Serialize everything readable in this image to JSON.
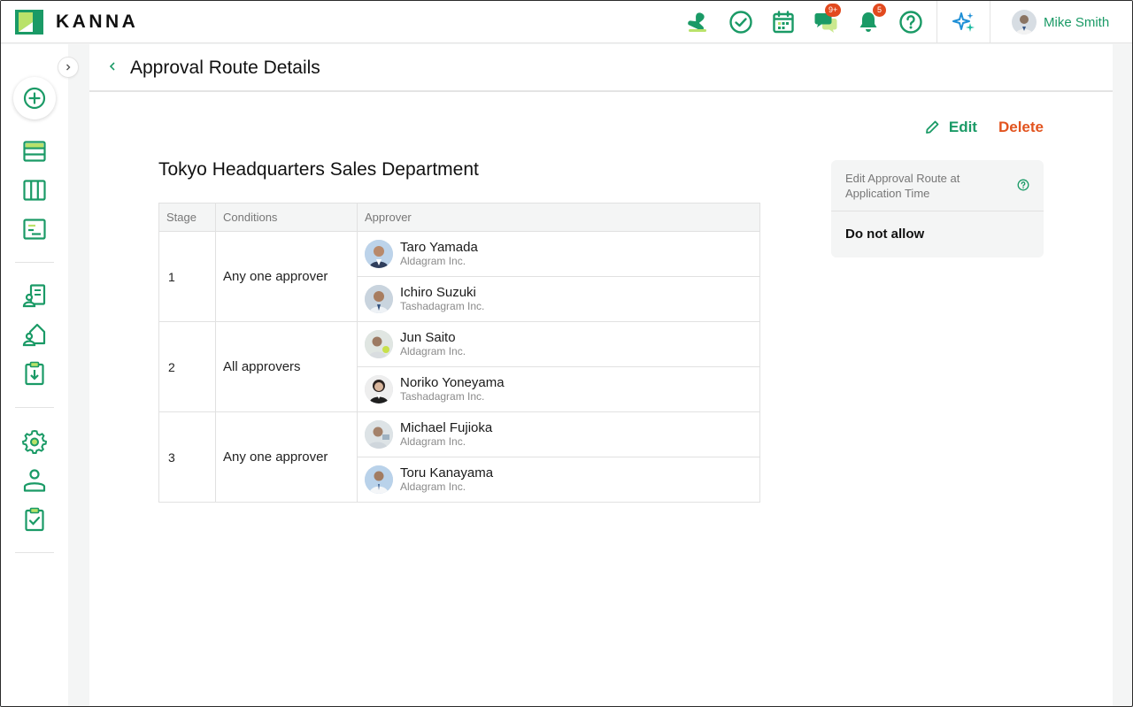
{
  "app": {
    "name": "KANNA"
  },
  "header": {
    "badges": {
      "messages": "9+",
      "notifications": "5"
    },
    "user_name": "Mike Smith",
    "accent": "#1a9a66",
    "badge_color": "#e24a1f",
    "icons": [
      "stamp-icon",
      "check-circle-icon",
      "calendar-icon",
      "chat-icon",
      "bell-icon",
      "help-icon",
      "sparkle-icon"
    ]
  },
  "sidebar": {
    "icons": [
      "add-icon",
      "list-icon",
      "columns-icon",
      "document-icon",
      "building-person-icon",
      "house-person-icon",
      "download-clipboard-icon",
      "gear-icon",
      "person-icon",
      "clipboard-check-icon"
    ]
  },
  "page": {
    "title": "Approval Route Details",
    "edit_label": "Edit",
    "delete_label": "Delete",
    "delete_color": "#e2541f",
    "route_name": "Tokyo Headquarters Sales Department"
  },
  "table": {
    "headers": {
      "stage": "Stage",
      "conditions": "Conditions",
      "approver": "Approver"
    },
    "stages": [
      {
        "stage": "1",
        "condition": "Any one approver",
        "approvers": [
          {
            "name": "Taro Yamada",
            "company": "Aldagram Inc."
          },
          {
            "name": "Ichiro Suzuki",
            "company": "Tashadagram Inc."
          }
        ]
      },
      {
        "stage": "2",
        "condition": "All approvers",
        "approvers": [
          {
            "name": "Jun Saito",
            "company": "Aldagram Inc."
          },
          {
            "name": "Noriko Yoneyama",
            "company": "Tashadagram Inc."
          }
        ]
      },
      {
        "stage": "3",
        "condition": "Any one approver",
        "approvers": [
          {
            "name": "Michael Fujioka",
            "company": "Aldagram Inc."
          },
          {
            "name": "Toru Kanayama",
            "company": "Aldagram Inc."
          }
        ]
      }
    ]
  },
  "side_card": {
    "label": "Edit Approval Route at Application Time",
    "value": "Do not allow"
  }
}
